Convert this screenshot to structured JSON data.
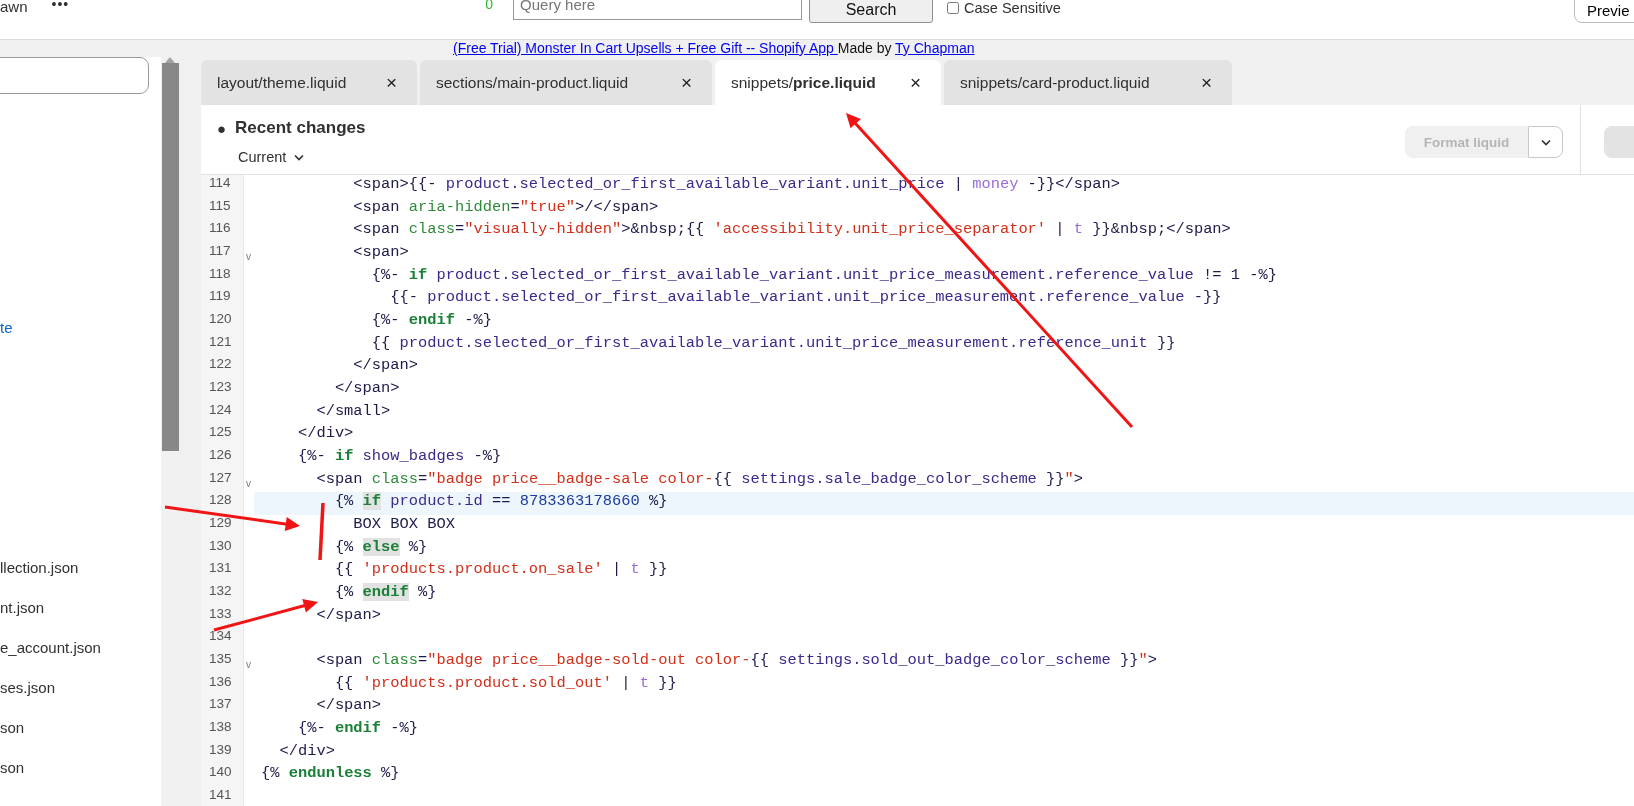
{
  "top_bar": {
    "title": "awn",
    "menu": "•••",
    "count": "0",
    "query": {
      "placeholder": "Query here"
    },
    "search_button": "Search",
    "case_sensitive": {
      "label": "Case Sensitive",
      "checked": false
    },
    "preview_button": "Previe"
  },
  "banner": {
    "app_link": "(Free Trial) Monster In Cart Upsells + Free Gift -- Shopify App ",
    "made_by": "Made by",
    "author_link": "Ty Chapman"
  },
  "sidebar": {
    "link": "te",
    "files": [
      "llection.json",
      "nt.json",
      "e_account.json",
      "ses.json",
      "son",
      "son"
    ]
  },
  "tabs": [
    {
      "folder": "layout/",
      "file": "theme.liquid",
      "close": "×",
      "selected": false
    },
    {
      "folder": "sections/",
      "file": "main-product.liquid",
      "close": "×",
      "selected": false
    },
    {
      "folder": "snippets/",
      "file": "price.liquid",
      "close": "×",
      "selected": true
    },
    {
      "folder": "snippets/",
      "file": "card-product.liquid",
      "close": "×",
      "selected": false
    }
  ],
  "header": {
    "bullet": "●",
    "title": "Recent changes",
    "version": "Current",
    "format_button": {
      "label": "Format liquid",
      "disabled": true
    }
  },
  "code": {
    "lines": [
      {
        "number": "114",
        "active": false,
        "tokens": [
          {
            "kind": "plain",
            "text": "          <span>{{- "
          },
          {
            "kind": "variable",
            "text": "product.selected_or_first_available_variant.unit_price"
          },
          {
            "kind": "plain",
            "text": " | "
          },
          {
            "kind": "filter",
            "text": "money"
          },
          {
            "kind": "plain",
            "text": " -}}</span>"
          }
        ]
      },
      {
        "number": "115",
        "active": false,
        "tokens": [
          {
            "kind": "plain",
            "text": "          <span "
          },
          {
            "kind": "attribute",
            "text": "aria-hidden"
          },
          {
            "kind": "plain",
            "text": "="
          },
          {
            "kind": "string",
            "text": "\"true\""
          },
          {
            "kind": "plain",
            "text": ">/</span>"
          }
        ]
      },
      {
        "number": "116",
        "active": false,
        "tokens": [
          {
            "kind": "plain",
            "text": "          <span "
          },
          {
            "kind": "attribute",
            "text": "class"
          },
          {
            "kind": "plain",
            "text": "="
          },
          {
            "kind": "string",
            "text": "\"visually-hidden\""
          },
          {
            "kind": "plain",
            "text": ">&nbsp;{{ "
          },
          {
            "kind": "string",
            "text": "'accessibility.unit_price_separator'"
          },
          {
            "kind": "plain",
            "text": " | "
          },
          {
            "kind": "filter",
            "text": "t"
          },
          {
            "kind": "plain",
            "text": " }}&nbsp;</span>"
          }
        ]
      },
      {
        "number": "117",
        "fold": "v",
        "active": false,
        "tokens": [
          {
            "kind": "plain",
            "text": "          <span>"
          }
        ]
      },
      {
        "number": "118",
        "active": false,
        "tokens": [
          {
            "kind": "plain",
            "text": "            {%- "
          },
          {
            "kind": "keyword",
            "text": "if"
          },
          {
            "kind": "variable",
            "text": " product.selected_or_first_available_variant.unit_price_measurement.reference_value"
          },
          {
            "kind": "plain",
            "text": " != 1 -%}"
          }
        ]
      },
      {
        "number": "119",
        "active": false,
        "tokens": [
          {
            "kind": "plain",
            "text": "              {{- "
          },
          {
            "kind": "variable",
            "text": "product.selected_or_first_available_variant.unit_price_measurement.reference_value"
          },
          {
            "kind": "plain",
            "text": " -}}"
          }
        ]
      },
      {
        "number": "120",
        "active": false,
        "tokens": [
          {
            "kind": "plain",
            "text": "            {%- "
          },
          {
            "kind": "keyword",
            "text": "endif"
          },
          {
            "kind": "plain",
            "text": " -%}"
          }
        ]
      },
      {
        "number": "121",
        "active": false,
        "tokens": [
          {
            "kind": "plain",
            "text": "            {{ "
          },
          {
            "kind": "variable",
            "text": "product.selected_or_first_available_variant.unit_price_measurement.reference_unit"
          },
          {
            "kind": "plain",
            "text": " }}"
          }
        ]
      },
      {
        "number": "122",
        "active": false,
        "tokens": [
          {
            "kind": "plain",
            "text": "          </span>"
          }
        ]
      },
      {
        "number": "123",
        "active": false,
        "tokens": [
          {
            "kind": "plain",
            "text": "        </span>"
          }
        ]
      },
      {
        "number": "124",
        "active": false,
        "tokens": [
          {
            "kind": "plain",
            "text": "      </small>"
          }
        ]
      },
      {
        "number": "125",
        "active": false,
        "tokens": [
          {
            "kind": "plain",
            "text": "    </div>"
          }
        ]
      },
      {
        "number": "126",
        "active": false,
        "tokens": [
          {
            "kind": "plain",
            "text": "    {%- "
          },
          {
            "kind": "keyword",
            "text": "if"
          },
          {
            "kind": "variable",
            "text": " show_badges"
          },
          {
            "kind": "plain",
            "text": " -%}"
          }
        ]
      },
      {
        "number": "127",
        "fold": "v",
        "active": false,
        "tokens": [
          {
            "kind": "plain",
            "text": "      <span "
          },
          {
            "kind": "attribute",
            "text": "class"
          },
          {
            "kind": "plain",
            "text": "="
          },
          {
            "kind": "string",
            "text": "\"badge price__badge-sale color-"
          },
          {
            "kind": "plain",
            "text": "{{ "
          },
          {
            "kind": "variable",
            "text": "settings.sale_badge_color_scheme"
          },
          {
            "kind": "plain",
            "text": " }}"
          },
          {
            "kind": "string",
            "text": "\""
          },
          {
            "kind": "plain",
            "text": ">"
          }
        ]
      },
      {
        "number": "128",
        "active": true,
        "tokens": [
          {
            "kind": "plain",
            "text": "        {% "
          },
          {
            "kind": "matched",
            "text": "if"
          },
          {
            "kind": "variable",
            "text": " product.id"
          },
          {
            "kind": "plain",
            "text": " == "
          },
          {
            "kind": "number",
            "text": "8783363178660"
          },
          {
            "kind": "plain",
            "text": " %}"
          }
        ]
      },
      {
        "number": "129",
        "active": false,
        "tokens": [
          {
            "kind": "plain",
            "text": "          BOX BOX BOX"
          }
        ]
      },
      {
        "number": "130",
        "active": false,
        "tokens": [
          {
            "kind": "plain",
            "text": "        {% "
          },
          {
            "kind": "matched",
            "text": "else"
          },
          {
            "kind": "plain",
            "text": " %}"
          }
        ]
      },
      {
        "number": "131",
        "active": false,
        "tokens": [
          {
            "kind": "plain",
            "text": "        {{ "
          },
          {
            "kind": "string",
            "text": "'products.product.on_sale'"
          },
          {
            "kind": "plain",
            "text": " | "
          },
          {
            "kind": "filter",
            "text": "t"
          },
          {
            "kind": "plain",
            "text": " }}"
          }
        ]
      },
      {
        "number": "132",
        "active": false,
        "tokens": [
          {
            "kind": "plain",
            "text": "        {% "
          },
          {
            "kind": "matched",
            "text": "endif"
          },
          {
            "kind": "plain",
            "text": " %}"
          }
        ]
      },
      {
        "number": "133",
        "active": false,
        "tokens": [
          {
            "kind": "plain",
            "text": "      </span>"
          }
        ]
      },
      {
        "number": "134",
        "active": false
      },
      {
        "number": "135",
        "fold": "v",
        "active": false,
        "tokens": [
          {
            "kind": "plain",
            "text": "      <span "
          },
          {
            "kind": "attribute",
            "text": "class"
          },
          {
            "kind": "plain",
            "text": "="
          },
          {
            "kind": "string",
            "text": "\"badge price__badge-sold-out color-"
          },
          {
            "kind": "plain",
            "text": "{{ "
          },
          {
            "kind": "variable",
            "text": "settings.sold_out_badge_color_scheme"
          },
          {
            "kind": "plain",
            "text": " }}"
          },
          {
            "kind": "string",
            "text": "\""
          },
          {
            "kind": "plain",
            "text": ">"
          }
        ]
      },
      {
        "number": "136",
        "active": false,
        "tokens": [
          {
            "kind": "plain",
            "text": "        {{ "
          },
          {
            "kind": "string",
            "text": "'products.product.sold_out'"
          },
          {
            "kind": "plain",
            "text": " | "
          },
          {
            "kind": "filter",
            "text": "t"
          },
          {
            "kind": "plain",
            "text": " }}"
          }
        ]
      },
      {
        "number": "137",
        "active": false,
        "tokens": [
          {
            "kind": "plain",
            "text": "      </span>"
          }
        ]
      },
      {
        "number": "138",
        "active": false,
        "tokens": [
          {
            "kind": "plain",
            "text": "    {%- "
          },
          {
            "kind": "keyword",
            "text": "endif"
          },
          {
            "kind": "plain",
            "text": " -%}"
          }
        ]
      },
      {
        "number": "139",
        "active": false,
        "tokens": [
          {
            "kind": "plain",
            "text": "  </div>"
          }
        ]
      },
      {
        "number": "140",
        "active": false,
        "tokens": [
          {
            "kind": "plain",
            "text": "{% "
          },
          {
            "kind": "keyword",
            "text": "endunless"
          },
          {
            "kind": "plain",
            "text": " %}"
          }
        ]
      },
      {
        "number": "141",
        "active": false
      }
    ]
  }
}
